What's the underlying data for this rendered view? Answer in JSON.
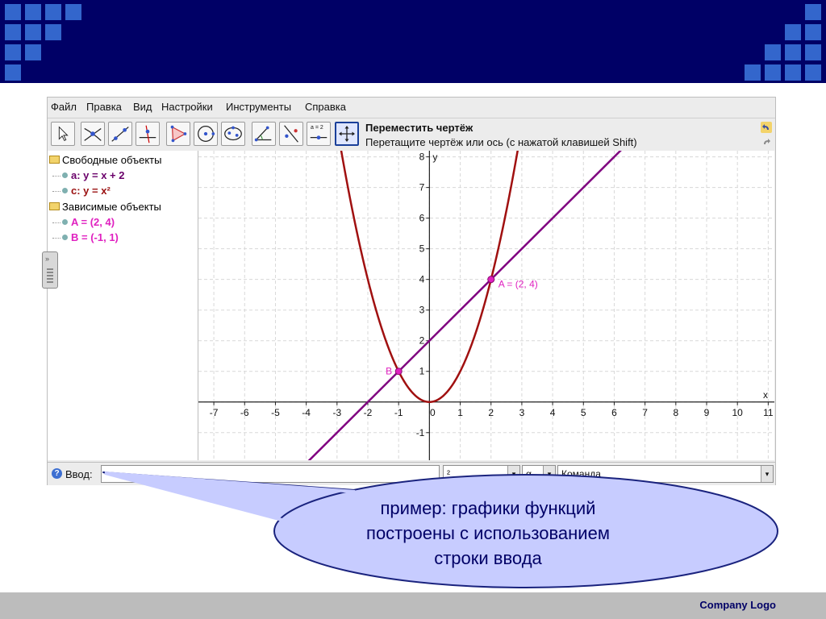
{
  "menu": [
    "Файл",
    "Правка",
    "Вид",
    "Настройки",
    "Инструменты",
    "Справка"
  ],
  "toolbar": {
    "tools": [
      "move-tool",
      "point-tool",
      "line-tool",
      "perpendicular-tool",
      "polygon-tool",
      "circle-tool",
      "conic-tool",
      "angle-tool",
      "reflect-tool",
      "slider-tool",
      "move-graphics-tool"
    ],
    "slider_icon_text": "a = 2",
    "active_title": "Переместить чертёж",
    "active_help": "Перетащите чертёж или ось (с нажатой клавишей Shift)"
  },
  "algebra": {
    "free_header": "Свободные объекты",
    "free_items": [
      "a: y = x + 2",
      "c: y = x²"
    ],
    "dependent_header": "Зависимые объекты",
    "dependent_items": [
      "A = (2, 4)",
      "B = (-1, 1)"
    ]
  },
  "graph": {
    "x_axis_label": "x",
    "y_axis_label": "y",
    "x_ticks": [
      -7,
      -6,
      -5,
      -4,
      -3,
      -2,
      -1,
      0,
      1,
      2,
      3,
      4,
      5,
      6,
      7,
      8,
      9,
      10,
      11
    ],
    "y_ticks": [
      8,
      7,
      6,
      5,
      4,
      3,
      2,
      1,
      0,
      -1
    ],
    "x_range": [
      -7.5,
      11.2
    ],
    "y_range": [
      -1.9,
      8.2
    ],
    "line": {
      "slope": 1,
      "intercept": 2,
      "color": "#800080"
    },
    "parabola": {
      "coefficient": 1,
      "color": "#a01010"
    },
    "points": [
      {
        "x": 2,
        "y": 4,
        "label": "A = (2, 4)"
      },
      {
        "x": -1,
        "y": 1,
        "label": "B"
      }
    ],
    "point_color": "#e020c0"
  },
  "input": {
    "label": "Ввод:",
    "value": "",
    "combo1": "²",
    "combo2": "α",
    "command": "Команда"
  },
  "callout": {
    "lines": [
      "пример: графики функций",
      "построены с использованием",
      "строки ввода"
    ]
  },
  "footer": {
    "logo": "Company  Logo"
  },
  "colors": {
    "banner": "#000066",
    "banner_squares": "#3366cc",
    "callout_fill": "#c7ccff",
    "footer": "#bcbcbc"
  }
}
